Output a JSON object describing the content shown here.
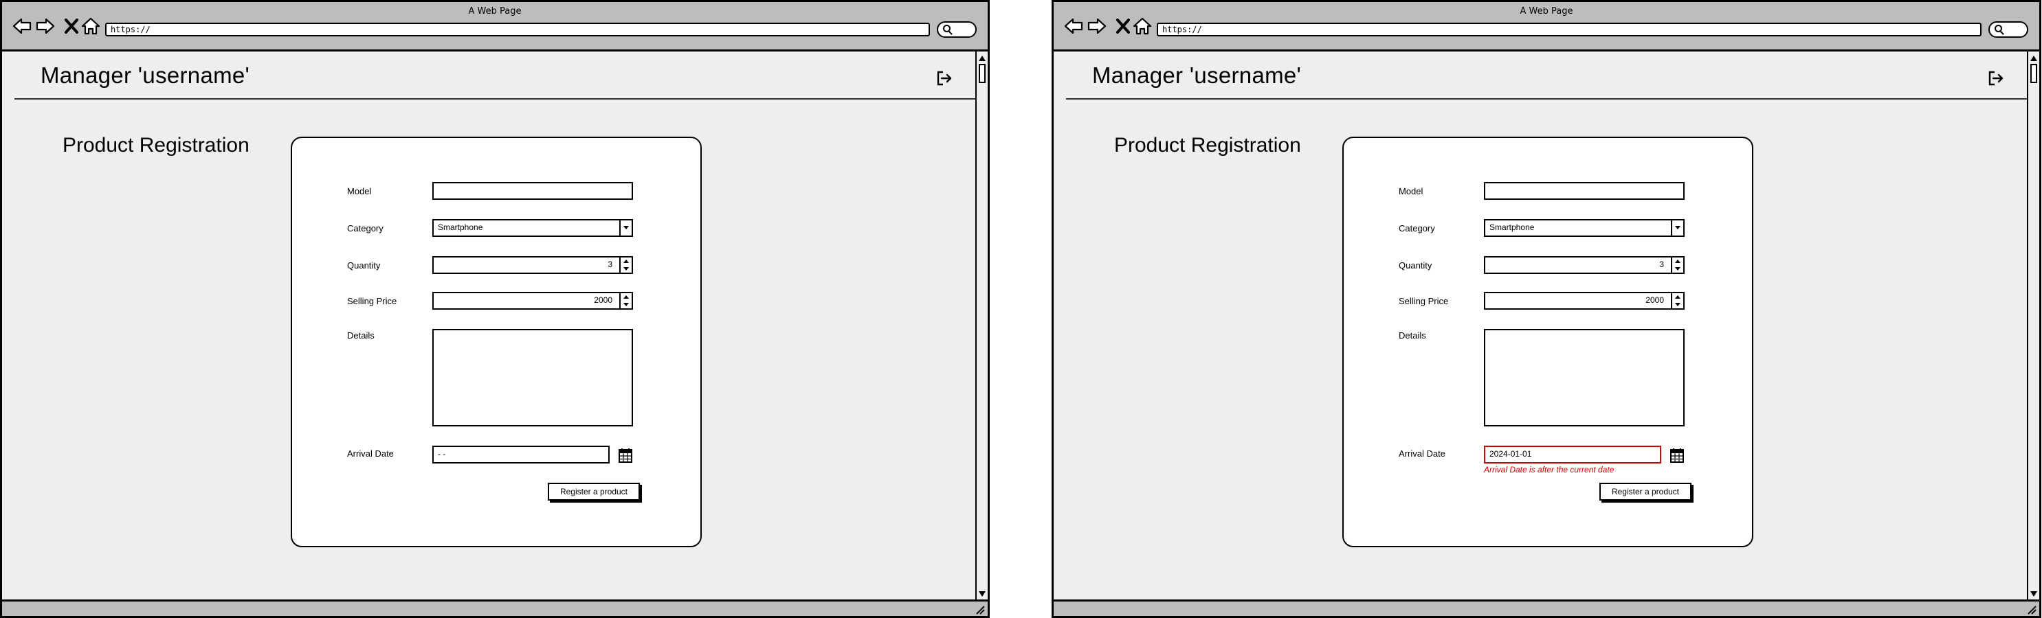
{
  "windows": [
    {
      "window_title": "A Web Page",
      "url": "https://",
      "header_title": "Manager 'username'",
      "page_heading": "Product Registration",
      "form": {
        "model_label": "Model",
        "model_value": "",
        "category_label": "Category",
        "category_value": "Smartphone",
        "quantity_label": "Quantity",
        "quantity_value": "3",
        "price_label": "Selling Price",
        "price_value": "2000",
        "details_label": "Details",
        "details_value": "",
        "arrival_label": "Arrival Date",
        "arrival_value": "- -",
        "arrival_error": "",
        "submit_label": "Register a product"
      }
    },
    {
      "window_title": "A Web Page",
      "url": "https://",
      "header_title": "Manager 'username'",
      "page_heading": "Product Registration",
      "form": {
        "model_label": "Model",
        "model_value": "",
        "category_label": "Category",
        "category_value": "Smartphone",
        "quantity_label": "Quantity",
        "quantity_value": "3",
        "price_label": "Selling Price",
        "price_value": "2000",
        "details_label": "Details",
        "details_value": "",
        "arrival_label": "Arrival Date",
        "arrival_value": "2024-01-01",
        "arrival_error": "Arrival Date is after the current date",
        "submit_label": "Register a product"
      }
    }
  ],
  "icons": {
    "back": "arrow-left-icon",
    "forward": "arrow-right-icon",
    "stop": "close-icon",
    "home": "home-icon",
    "search": "search-icon",
    "logout": "logout-icon",
    "calendar": "calendar-icon"
  },
  "colors": {
    "chrome": "#bdbdbd",
    "page_bg": "#eeeeee",
    "error": "#cc0000"
  }
}
